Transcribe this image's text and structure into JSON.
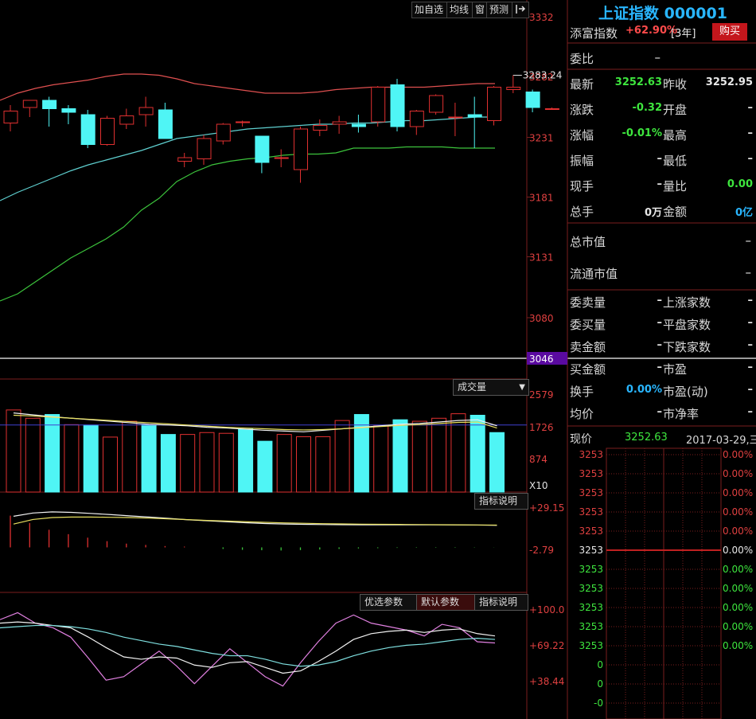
{
  "toolbar": {
    "add_watch": "加自选",
    "ma": "均线",
    "window": "窗",
    "forecast": "预测",
    "exit_icon": "exit-icon"
  },
  "price_axis": [
    "3332",
    "3282",
    "3231",
    "3181",
    "3131",
    "3080"
  ],
  "cursor_price": "3046",
  "volume_axis": [
    "2579",
    "1726",
    "874",
    "X10"
  ],
  "volume_menu": "成交量",
  "macd_axis": [
    "+29.15",
    "-2.79"
  ],
  "macd_help": "指标说明",
  "kdj_tabs": {
    "optimize": "优选参数",
    "default": "默认参数",
    "help": "指标说明"
  },
  "kdj_axis": [
    "+100.0",
    "+69.22",
    "+38.44"
  ],
  "colors": {
    "up": "#e03030",
    "down": "#4ff5f5",
    "mid_band": "#5fd0d0",
    "upper_band": "#e05050",
    "lower_band": "#3cc43c",
    "grid": "#7a1e1e"
  },
  "chart_data": [
    {
      "type": "candlestick",
      "panel": "price",
      "ylim": [
        3046,
        3332
      ],
      "annotations": [
        {
          "text": "3283.24"
        }
      ],
      "candles": [
        {
          "o": 3243,
          "h": 3258,
          "l": 3236,
          "c": 3253
        },
        {
          "o": 3256,
          "h": 3262,
          "l": 3248,
          "c": 3262
        },
        {
          "o": 3262,
          "h": 3265,
          "l": 3240,
          "c": 3255
        },
        {
          "o": 3255,
          "h": 3258,
          "l": 3242,
          "c": 3252
        },
        {
          "o": 3250,
          "h": 3254,
          "l": 3222,
          "c": 3225
        },
        {
          "o": 3225,
          "h": 3249,
          "l": 3224,
          "c": 3247
        },
        {
          "o": 3242,
          "h": 3255,
          "l": 3238,
          "c": 3249
        },
        {
          "o": 3250,
          "h": 3265,
          "l": 3240,
          "c": 3256
        },
        {
          "o": 3254,
          "h": 3260,
          "l": 3230,
          "c": 3230
        },
        {
          "o": 3211,
          "h": 3218,
          "l": 3206,
          "c": 3214
        },
        {
          "o": 3213,
          "h": 3233,
          "l": 3208,
          "c": 3230
        },
        {
          "o": 3228,
          "h": 3243,
          "l": 3225,
          "c": 3242
        },
        {
          "o": 3244,
          "h": 3245,
          "l": 3240,
          "c": 3244
        },
        {
          "o": 3232,
          "h": 3232,
          "l": 3201,
          "c": 3210
        },
        {
          "o": 3214,
          "h": 3221,
          "l": 3206,
          "c": 3214
        },
        {
          "o": 3204,
          "h": 3240,
          "l": 3193,
          "c": 3238
        },
        {
          "o": 3237,
          "h": 3246,
          "l": 3232,
          "c": 3241
        },
        {
          "o": 3242,
          "h": 3249,
          "l": 3234,
          "c": 3244
        },
        {
          "o": 3242,
          "h": 3250,
          "l": 3235,
          "c": 3240
        },
        {
          "o": 3244,
          "h": 3274,
          "l": 3240,
          "c": 3273
        },
        {
          "o": 3275,
          "h": 3280,
          "l": 3236,
          "c": 3240
        },
        {
          "o": 3240,
          "h": 3254,
          "l": 3233,
          "c": 3253
        },
        {
          "o": 3252,
          "h": 3267,
          "l": 3250,
          "c": 3266
        },
        {
          "o": 3248,
          "h": 3260,
          "l": 3232,
          "c": 3248
        },
        {
          "o": 3250,
          "h": 3265,
          "l": 3222,
          "c": 3248
        },
        {
          "o": 3245,
          "h": 3274,
          "l": 3241,
          "c": 3273
        },
        {
          "o": 3271,
          "h": 3283,
          "l": 3268,
          "c": 3273
        },
        {
          "o": 3269,
          "h": 3271,
          "l": 3252,
          "c": 3256
        },
        {
          "o": 3255,
          "h": 3256,
          "l": 3254,
          "c": 3255
        }
      ],
      "bands": {
        "upper": [
          3262,
          3268,
          3272,
          3275,
          3277,
          3279,
          3282,
          3284,
          3284,
          3283,
          3280,
          3276,
          3274,
          3272,
          3270,
          3268,
          3268,
          3268,
          3269,
          3271,
          3272,
          3273,
          3273,
          3273,
          3273,
          3274,
          3275,
          3276,
          3276
        ],
        "middle": [
          3178,
          3185,
          3191,
          3197,
          3203,
          3208,
          3212,
          3216,
          3220,
          3225,
          3230,
          3232,
          3234,
          3236,
          3238,
          3239,
          3240,
          3241,
          3242,
          3242,
          3243,
          3243,
          3244,
          3245,
          3245,
          3246,
          3247,
          3248,
          3248
        ],
        "lower": [
          3094,
          3100,
          3110,
          3120,
          3130,
          3138,
          3146,
          3156,
          3170,
          3180,
          3194,
          3202,
          3208,
          3211,
          3213,
          3214,
          3216,
          3217,
          3217,
          3218,
          3222,
          3222,
          3222,
          3223,
          3223,
          3223,
          3222,
          3222,
          3222
        ]
      }
    },
    {
      "type": "bar",
      "panel": "volume",
      "ylim": [
        0,
        2579
      ],
      "values": [
        2180,
        1960,
        2060,
        1790,
        1780,
        1460,
        1880,
        1790,
        1530,
        1530,
        1580,
        1560,
        1670,
        1350,
        1530,
        1470,
        1470,
        1900,
        2060,
        1760,
        1920,
        1880,
        1960,
        2080,
        2040,
        1580
      ],
      "up": [
        true,
        true,
        false,
        true,
        false,
        true,
        true,
        false,
        false,
        true,
        true,
        true,
        false,
        false,
        true,
        true,
        true,
        true,
        false,
        true,
        false,
        true,
        true,
        true,
        false,
        false
      ],
      "lines": {
        "ma5": [
          2100,
          2050,
          2000,
          1960,
          1920,
          1880,
          1840,
          1800,
          1780,
          1760,
          1720,
          1700,
          1670,
          1640,
          1620,
          1600,
          1640,
          1680,
          1720,
          1760,
          1800,
          1820,
          1860,
          1900,
          1920,
          1760
        ],
        "ma10": [
          2040,
          2020,
          1990,
          1960,
          1930,
          1900,
          1870,
          1840,
          1810,
          1780,
          1750,
          1720,
          1700,
          1680,
          1660,
          1650,
          1660,
          1680,
          1710,
          1740,
          1770,
          1790,
          1820,
          1850,
          1860,
          1700
        ]
      }
    },
    {
      "type": "bar",
      "panel": "macd",
      "ylim": [
        -2.79,
        29.15
      ],
      "values": [
        24.5,
        18.8,
        13.6,
        10.2,
        7.5,
        4.8,
        2.9,
        1.9,
        1.0,
        0.6,
        0.0,
        -1.2,
        -1.9,
        -2.2,
        -2.4,
        -2.1,
        -1.7,
        -1.2,
        -0.8,
        -0.6,
        -0.4,
        -0.3,
        -0.3,
        -0.3,
        -0.2,
        -0.1
      ],
      "lines": {
        "dif": [
          24,
          26.5,
          27.4,
          27.0,
          26.2,
          25.3,
          24.3,
          23.4,
          22.4,
          21.3,
          20.5,
          19.8,
          19.0,
          18.4,
          18.0,
          17.8,
          17.6,
          17.5,
          17.4,
          17.4,
          17.4,
          17.4,
          17.4,
          17.3,
          17.2,
          17.0
        ],
        "dea": [
          18,
          21.5,
          23.0,
          23.4,
          23.4,
          23.2,
          23.0,
          22.6,
          22.0,
          21.4,
          20.8,
          20.3,
          19.8,
          19.3,
          18.9,
          18.6,
          18.3,
          18.1,
          17.9,
          17.8,
          17.7,
          17.6,
          17.5,
          17.4,
          17.3,
          17.2
        ]
      }
    },
    {
      "type": "line",
      "panel": "kdj",
      "ylim": [
        38.44,
        100.0
      ],
      "series": [
        {
          "values": [
            93,
            99,
            90,
            86,
            78,
            60,
            41,
            44,
            55,
            66,
            53,
            38,
            53,
            68,
            56,
            44,
            36,
            56,
            74,
            90,
            97,
            90,
            87,
            84,
            79,
            89,
            86,
            74,
            73
          ]
        },
        {
          "values": [
            90,
            91,
            90,
            88,
            86,
            78,
            69,
            61,
            59,
            61,
            60,
            54,
            52,
            56,
            57,
            52,
            47,
            49,
            57,
            66,
            76,
            81,
            83,
            84,
            82,
            84,
            85,
            81,
            79
          ]
        },
        {
          "values": [
            86,
            87,
            88,
            88,
            87,
            85,
            82,
            78,
            75,
            72,
            70,
            67,
            64,
            62,
            62,
            59,
            55,
            53,
            54,
            57,
            62,
            66,
            69,
            71,
            72,
            74,
            76,
            77,
            76
          ]
        }
      ]
    }
  ],
  "quote": {
    "title": "上证指数 000001",
    "tiancai_label": "添富指数",
    "tiancai_value": "+62.90%",
    "tiancai_period": "[3年]",
    "buy_button": "购买",
    "weibi_label": "委比",
    "weibi_value": "–",
    "rows": [
      {
        "l1": "最新",
        "v1": "3252.63",
        "c1": "green",
        "l2": "昨收",
        "v2": "3252.95",
        "c2": "white"
      },
      {
        "l1": "涨跌",
        "v1": "-0.32",
        "c1": "green",
        "l2": "开盘",
        "v2": "–",
        "c2": "white"
      },
      {
        "l1": "涨幅",
        "v1": "-0.01%",
        "c1": "green",
        "l2": "最高",
        "v2": "–",
        "c2": "white"
      },
      {
        "l1": "振幅",
        "v1": "–",
        "c1": "white",
        "l2": "最低",
        "v2": "–",
        "c2": "white"
      },
      {
        "l1": "现手",
        "v1": "–",
        "c1": "white",
        "l2": "量比",
        "v2": "0.00",
        "c2": "green"
      },
      {
        "l1": "总手",
        "v1": "0万",
        "c1": "white",
        "l2": "金额",
        "v2": "0亿",
        "c2": "cyan"
      }
    ],
    "market_cap": "总市值",
    "market_cap_value": "–",
    "float_cap": "流通市值",
    "float_cap_value": "–",
    "rows2": [
      {
        "l1": "委卖量",
        "v1": "–",
        "c1": "white",
        "l2": "上涨家数",
        "v2": "–"
      },
      {
        "l1": "委买量",
        "v1": "–",
        "c1": "white",
        "l2": "平盘家数",
        "v2": "–"
      },
      {
        "l1": "卖金额",
        "v1": "–",
        "c1": "white",
        "l2": "下跌家数",
        "v2": "–"
      },
      {
        "l1": "买金额",
        "v1": "–",
        "c1": "white",
        "l2": "市盈",
        "v2": "–"
      },
      {
        "l1": "换手",
        "v1": "0.00%",
        "c1": "cyan",
        "l2": "市盈(动)",
        "v2": "–"
      },
      {
        "l1": "均价",
        "v1": "–",
        "c1": "white",
        "l2": "市净率",
        "v2": "–"
      }
    ],
    "now_label": "现价",
    "now_value": "3252.63",
    "date": "2017-03-29,三",
    "mini_left": [
      "3253",
      "3253",
      "3253",
      "3253",
      "3253",
      "3253",
      "3253",
      "3253",
      "3253",
      "3253",
      "3253",
      "0",
      "0",
      "-0"
    ],
    "mini_right": [
      "0.00%",
      "0.00%",
      "0.00%",
      "0.00%",
      "0.00%",
      "0.00%",
      "0.00%",
      "0.00%",
      "0.00%",
      "0.00%",
      "0.00%"
    ]
  }
}
